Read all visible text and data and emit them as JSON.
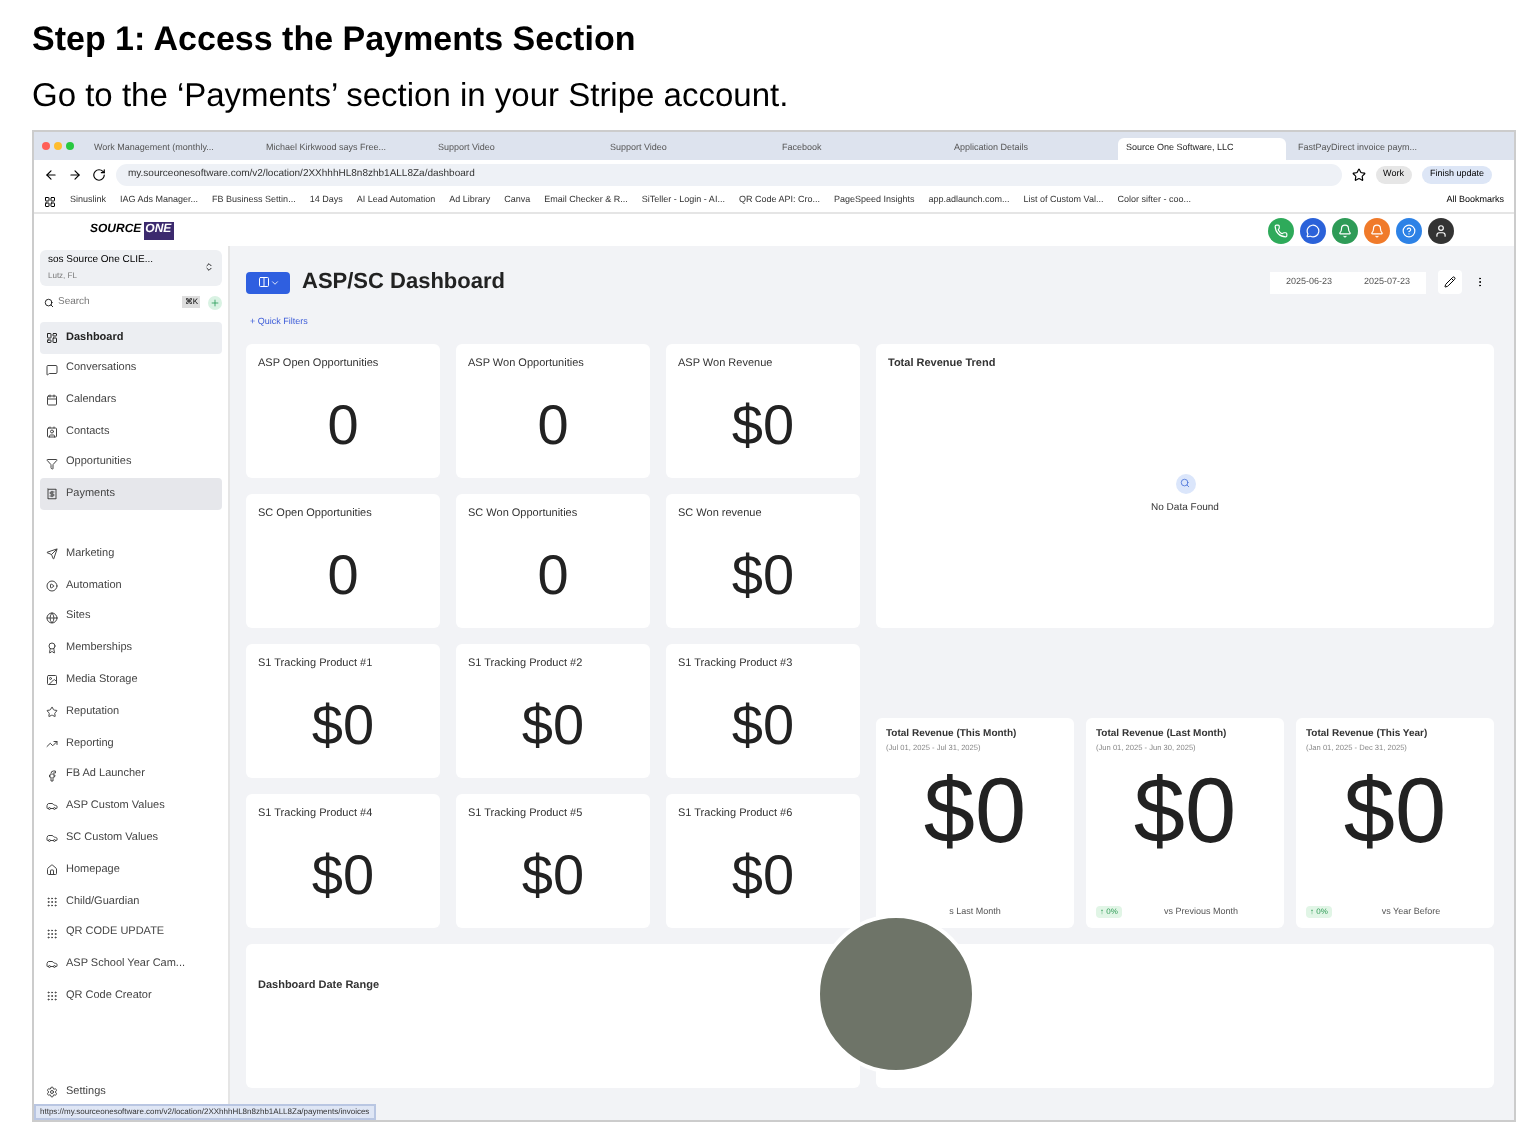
{
  "heading": "Step 1: Access the Payments Section",
  "instruction": "Go to the ‘Payments’ section in your Stripe account.",
  "browser": {
    "tabs": [
      {
        "label": "Work Management (monthly...",
        "selected": false
      },
      {
        "label": "Michael Kirkwood says Free...",
        "selected": false
      },
      {
        "label": "Support Video",
        "selected": false
      },
      {
        "label": "Support Video",
        "selected": false
      },
      {
        "label": "Facebook",
        "selected": false
      },
      {
        "label": "Application Details",
        "selected": false
      },
      {
        "label": "Source One Software, LLC",
        "selected": true
      },
      {
        "label": "FastPayDirect invoice paym...",
        "selected": false
      }
    ],
    "address": "my.sourceonesoftware.com/v2/location/2XXhhhHL8n8zhb1ALL8Za/dashboard",
    "profile": "Work",
    "update_button": "Finish update",
    "bookmarks": [
      "Sinuslink",
      "IAG Ads Manager...",
      "FB Business Settin...",
      "14 Days",
      "AI Lead Automation",
      "Ad Library",
      "Canva",
      "Email Checker & R...",
      "SiTeller - Login - AI...",
      "QR Code API: Cro...",
      "PageSpeed Insights",
      "app.adlaunch.com...",
      "List of Custom Val...",
      "Color sifter - coo..."
    ],
    "all_bookmarks": "All Bookmarks",
    "status_url": "https://my.sourceonesoftware.com/v2/location/2XXhhhHL8n8zhb1ALL8Za/payments/invoices"
  },
  "app": {
    "logo": {
      "word1": "SOURCE",
      "word2": "ONE"
    },
    "account": {
      "name": "sos Source One CLIE...",
      "location": "Lutz, FL"
    },
    "search": {
      "placeholder": "Search",
      "shortcut": "⌘K"
    },
    "nav": [
      {
        "label": "Dashboard",
        "selected": true,
        "hovered": false
      },
      {
        "label": "Conversations",
        "selected": false,
        "hovered": false
      },
      {
        "label": "Calendars",
        "selected": false,
        "hovered": false
      },
      {
        "label": "Contacts",
        "selected": false,
        "hovered": false
      },
      {
        "label": "Opportunities",
        "selected": false,
        "hovered": false
      },
      {
        "label": "Payments",
        "selected": false,
        "hovered": true
      }
    ],
    "nav2": [
      {
        "label": "Marketing"
      },
      {
        "label": "Automation"
      },
      {
        "label": "Sites"
      },
      {
        "label": "Memberships"
      },
      {
        "label": "Media Storage"
      },
      {
        "label": "Reputation"
      },
      {
        "label": "Reporting"
      },
      {
        "label": "FB Ad Launcher"
      },
      {
        "label": "ASP Custom Values"
      },
      {
        "label": "SC Custom Values"
      },
      {
        "label": "Homepage"
      },
      {
        "label": "Child/Guardian"
      },
      {
        "label": "QR CODE UPDATE"
      },
      {
        "label": "ASP School Year Cam..."
      },
      {
        "label": "QR Code Creator"
      }
    ],
    "settings": "Settings",
    "dashboard": {
      "title": "ASP/SC Dashboard",
      "quick_filters": "Quick Filters",
      "quick_filters_plus": "+",
      "date_from": "2025-06-23",
      "date_to": "2025-07-23",
      "cards": [
        {
          "title": "ASP Open Opportunities",
          "value": "0"
        },
        {
          "title": "ASP Won Opportunities",
          "value": "0"
        },
        {
          "title": "ASP Won Revenue",
          "value": "$0"
        },
        {
          "title": "SC Open Opportunities",
          "value": "0"
        },
        {
          "title": "SC Won Opportunities",
          "value": "0"
        },
        {
          "title": "SC Won revenue",
          "value": "$0"
        },
        {
          "title": "S1 Tracking Product #1",
          "value": "$0"
        },
        {
          "title": "S1 Tracking Product #2",
          "value": "$0"
        },
        {
          "title": "S1 Tracking Product #3",
          "value": "$0"
        },
        {
          "title": "S1 Tracking Product #4",
          "value": "$0"
        },
        {
          "title": "S1 Tracking Product #5",
          "value": "$0"
        },
        {
          "title": "S1 Tracking Product #6",
          "value": "$0"
        }
      ],
      "trend": {
        "title": "Total Revenue Trend",
        "empty": "No Data Found"
      },
      "revenue": [
        {
          "title": "Total Revenue (This Month)",
          "range": "(Jul 01, 2025 - Jul 31, 2025)",
          "value": "$0",
          "comparison": "s Last Month"
        },
        {
          "title": "Total Revenue (Last Month)",
          "range": "(Jun 01, 2025 - Jun 30, 2025)",
          "value": "$0",
          "badge": "↑ 0%",
          "comparison": "vs Previous Month"
        },
        {
          "title": "Total Revenue (This Year)",
          "range": "(Jan 01, 2025 - Dec 31, 2025)",
          "value": "$0",
          "badge": "↑ 0%",
          "comparison": "vs Year Before"
        }
      ],
      "date_range": "Dashboard Date Range"
    }
  }
}
